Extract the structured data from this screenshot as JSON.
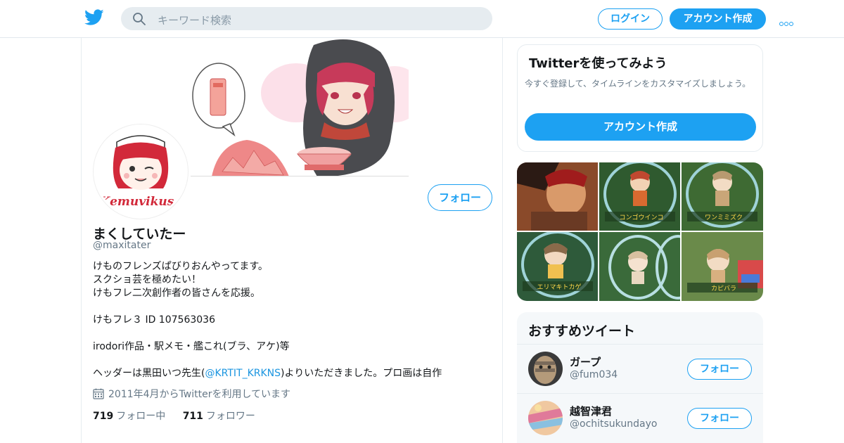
{
  "topbar": {
    "logo": "twitter-bird-icon",
    "search_placeholder": "キーワード検索",
    "login_label": "ログイン",
    "signup_label": "アカウント作成",
    "more_icon": "more-dots-icon"
  },
  "profile": {
    "name": "まくしていたー",
    "handle": "@maxitater",
    "avatar_text": "Kemuvikusa",
    "follow_label": "フォロー",
    "bio_lines": [
      "けものフレンズぱびりおんやってます。",
      "スクショ芸を極めたい！",
      "けもフレ二次創作者の皆さんを応援。",
      "けもフレ３ ID 107563036",
      "irodori作品・駅メモ・艦これ(ブラ、アケ)等"
    ],
    "bio_last_pre": "ヘッダーは黒田いつ先生(",
    "bio_last_link": "@KRTIT_KRKNS",
    "bio_last_post": ")よりいただきました。プロ画は自作",
    "joined": "2011年4月からTwitterを利用しています",
    "following_count": "719",
    "following_label": "フォロー中",
    "followers_count": "711",
    "followers_label": "フォロワー"
  },
  "signup_card": {
    "title": "Twitterを使ってみよう",
    "description": "今すぐ登録して、タイムラインをカスタマイズしましょう。",
    "button": "アカウント作成"
  },
  "media_grid": {
    "captions": [
      "",
      "コンゴウインコ",
      "ワンミミズク",
      "エリマキトカゲ",
      "",
      "カピバラ"
    ]
  },
  "recommended": {
    "title": "おすすめツイート",
    "items": [
      {
        "name": "ガープ",
        "handle": "@fum034",
        "follow": "フォロー"
      },
      {
        "name": "越智津君",
        "handle": "@ochitsukundayo",
        "follow": "フォロー"
      }
    ]
  },
  "colors": {
    "accent": "#1da1f2",
    "link": "#1b95e0",
    "muted": "#657786",
    "search_bg": "#e6ecf0",
    "card_bg": "#f5f8fa"
  }
}
